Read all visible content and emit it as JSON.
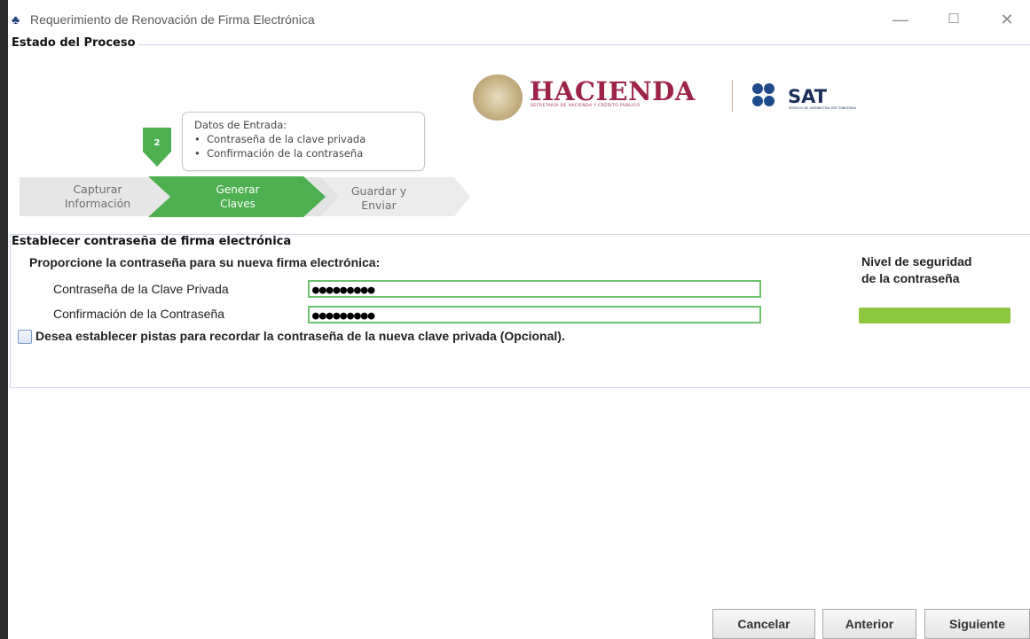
{
  "window": {
    "title": "Requerimiento de Renovación de Firma Electrónica",
    "minimize": "—",
    "maximize": "☐",
    "close": "✕"
  },
  "process": {
    "group_title": "Estado del Proceso",
    "step_number": "2",
    "tooltip": {
      "title": "Datos de Entrada:",
      "items": [
        "Contraseña de la clave privada",
        "Confirmación de la contraseña"
      ]
    },
    "steps": [
      {
        "line1": "Capturar",
        "line2": "Información",
        "state": "done"
      },
      {
        "line1": "Generar",
        "line2": "Claves",
        "state": "active"
      },
      {
        "line1": "Guardar y",
        "line2": "Enviar",
        "state": "pending"
      }
    ]
  },
  "logos": {
    "hacienda": "HACIENDA",
    "hacienda_sub": "SECRETARÍA DE HACIENDA Y CRÉDITO PÚBLICO",
    "sat": "SAT",
    "sat_sub": "SERVICIO DE ADMINISTRACIÓN TRIBUTARIA"
  },
  "form": {
    "group_title": "Establecer contraseña de firma electrónica",
    "instruction": "Proporcione la contraseña para su nueva firma electrónica:",
    "password_label": "Contraseña de la Clave Privada",
    "password_value": "●●●●●●●●●",
    "confirm_label": "Confirmación de la Contraseña",
    "confirm_value": "●●●●●●●●●",
    "hints_checkbox_label": "Desea establecer pistas para recordar la contraseña de la nueva clave privada (Opcional).",
    "security_title_1": "Nivel de seguridad",
    "security_title_2": "de la contraseña",
    "security_level": 1.0,
    "security_color": "#8cc63f"
  },
  "buttons": {
    "cancel": "Cancelar",
    "previous": "Anterior",
    "next": "Siguiente"
  },
  "colors": {
    "active_step": "#4caf50",
    "inactive_step": "#e6e6e6",
    "hacienda_red": "#9d2449",
    "sat_blue": "#1e4a8c"
  }
}
